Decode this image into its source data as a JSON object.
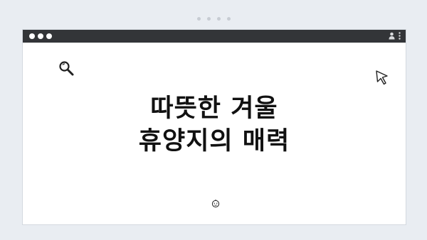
{
  "title": {
    "line1": "따뜻한 겨울",
    "line2": "휴양지의 매력"
  },
  "icons": {
    "top_dots": "page-indicator-dots",
    "window_controls": "window-dots-icon",
    "user": "user-icon",
    "more": "kebab-menu-icon",
    "search": "search-icon",
    "cursor": "cursor-icon",
    "face": "face-icon"
  },
  "colors": {
    "background": "#e9edf2",
    "window": "#ffffff",
    "titlebar": "#333538",
    "text": "#111111"
  }
}
